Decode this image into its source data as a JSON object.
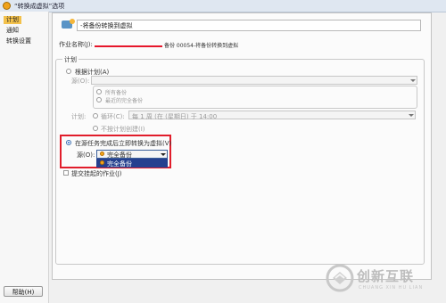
{
  "window": {
    "title": "“转换成虚拟”选项"
  },
  "sidebar": {
    "items": [
      {
        "label": "计划",
        "selected": true
      },
      {
        "label": "通知"
      },
      {
        "label": "转换设置"
      }
    ]
  },
  "header": {
    "title": "-将备份转换到虚拟"
  },
  "job": {
    "label": "作业名称(J):",
    "value": "备份 00054-将备份转换到虚拟"
  },
  "schedule": {
    "group_label": "计划",
    "by_schedule": {
      "label": "根据计划(A)"
    },
    "source": {
      "label": "源(O):"
    },
    "source_options": [
      "所有备份",
      "最近的完全备份"
    ],
    "plan": {
      "label": "计划:",
      "recurring": {
        "label": "循环(C):",
        "value": "每 1 周 (在 (星期日) 于 14:00"
      },
      "no_schedule": {
        "label": "不按计划创建(I)"
      }
    },
    "after_backup": {
      "label": "在源任务完成后立即转换为虚拟(V)",
      "source_label": "源(O):",
      "selected": "完全备份",
      "options": [
        "完全备份"
      ]
    },
    "hold": {
      "label": "提交挂起的作业(J)"
    }
  },
  "footer": {
    "help": "帮助(H)"
  },
  "watermark": {
    "name": "创新互联",
    "sub": "CHUANG XIN HU LIAN"
  }
}
